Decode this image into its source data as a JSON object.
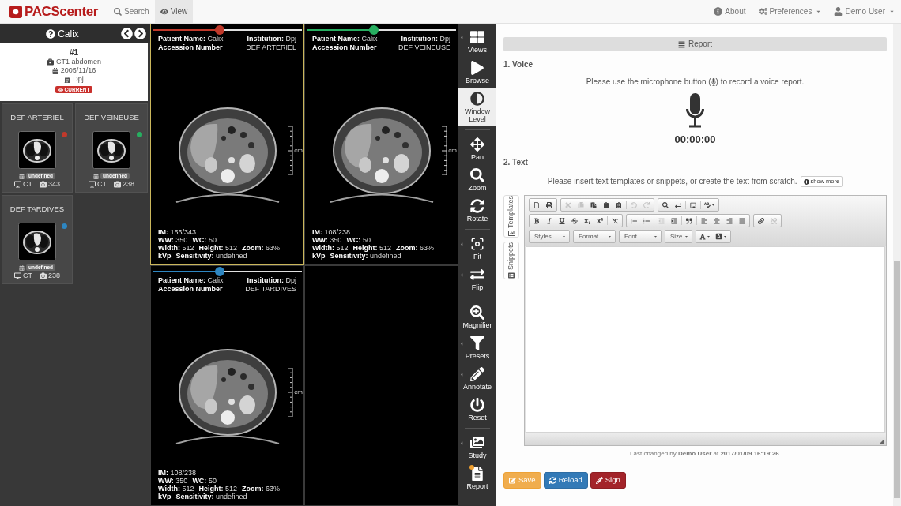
{
  "navbar": {
    "brand": "PACScenter",
    "tabs": [
      {
        "label": "Search",
        "selected": false
      },
      {
        "label": "View",
        "selected": true
      }
    ],
    "menu": [
      {
        "label": "About",
        "dropdown": false
      },
      {
        "label": "Preferences",
        "dropdown": true
      },
      {
        "label": "Demo User",
        "dropdown": true
      }
    ]
  },
  "sidebar": {
    "patient": "Calix",
    "study": {
      "number": "#1",
      "description": "CT1 abdomen",
      "date": "2005/11/16",
      "institution": "Dpj",
      "badge": "CURRENT"
    },
    "series": [
      {
        "title": "DEF ARTERIEL",
        "color": "#c0392b",
        "date": "undefined",
        "modality": "CT",
        "images": "343"
      },
      {
        "title": "DEF VEINEUSE",
        "color": "#27ae60",
        "date": "undefined",
        "modality": "CT",
        "images": "238"
      },
      {
        "title": "DEF TARDIVES",
        "color": "#2e86c1",
        "date": "undefined",
        "modality": "CT",
        "images": "238"
      }
    ]
  },
  "viewer": {
    "viewports": [
      {
        "kind": "series",
        "selected": true,
        "color": "#c0392b",
        "level": 0.45,
        "top": [
          [
            {
              "label": "Patient Name:",
              "value": "Calix"
            },
            {
              "label": "Institution:",
              "value": "Dpj"
            }
          ],
          [
            {
              "label": "Accession Number"
            },
            {
              "value": "DEF ARTERIEL"
            }
          ]
        ],
        "bottom": [
          [
            {
              "label": "IM:",
              "value": "156/343"
            }
          ],
          [
            {
              "label": "WW:",
              "value": "350"
            },
            {
              "label": "WC:",
              "value": "50"
            }
          ],
          [
            {
              "label": "Width:",
              "value": "512"
            },
            {
              "label": "Height:",
              "value": "512"
            },
            {
              "label": "Zoom:",
              "value": "63%"
            }
          ],
          [
            {
              "label": "kVp"
            },
            {
              "label": "Sensitivity:",
              "value": "undefined"
            }
          ]
        ],
        "ruler_unit": "cm"
      },
      {
        "kind": "series",
        "selected": false,
        "color": "#27ae60",
        "level": 0.45,
        "top": [
          [
            {
              "label": "Patient Name:",
              "value": "Calix"
            },
            {
              "label": "Institution:",
              "value": "Dpj"
            }
          ],
          [
            {
              "label": "Accession Number"
            },
            {
              "value": "DEF VEINEUSE"
            }
          ]
        ],
        "bottom": [
          [
            {
              "label": "IM:",
              "value": "108/238"
            }
          ],
          [
            {
              "label": "WW:",
              "value": "350"
            },
            {
              "label": "WC:",
              "value": "50"
            }
          ],
          [
            {
              "label": "Width:",
              "value": "512"
            },
            {
              "label": "Height:",
              "value": "512"
            },
            {
              "label": "Zoom:",
              "value": "63%"
            }
          ],
          [
            {
              "label": "kVp"
            },
            {
              "label": "Sensitivity:",
              "value": "undefined"
            }
          ]
        ],
        "ruler_unit": "cm"
      },
      {
        "kind": "series",
        "selected": false,
        "color": "#2e86c1",
        "level": 0.45,
        "top": [
          [
            {
              "label": "Patient Name:",
              "value": "Calix"
            },
            {
              "label": "Institution:",
              "value": "Dpj"
            }
          ],
          [
            {
              "label": "Accession Number"
            },
            {
              "value": "DEF TARDIVES"
            }
          ]
        ],
        "bottom": [
          [
            {
              "label": "IM:",
              "value": "108/238"
            }
          ],
          [
            {
              "label": "WW:",
              "value": "350"
            },
            {
              "label": "WC:",
              "value": "50"
            }
          ],
          [
            {
              "label": "Width:",
              "value": "512"
            },
            {
              "label": "Height:",
              "value": "512"
            },
            {
              "label": "Zoom:",
              "value": "63%"
            }
          ],
          [
            {
              "label": "kVp"
            },
            {
              "label": "Sensitivity:",
              "value": "undefined"
            }
          ]
        ],
        "ruler_unit": "cm"
      },
      {
        "kind": "empty"
      }
    ]
  },
  "tools": [
    [
      {
        "label": "Views",
        "selected": false,
        "submenu": true,
        "notice": false
      },
      {
        "label": "Browse",
        "selected": false,
        "submenu": false,
        "notice": false
      },
      {
        "label": "Window Level",
        "selected": true,
        "submenu": false,
        "notice": false
      }
    ],
    [
      {
        "label": "Pan",
        "selected": false,
        "submenu": false,
        "notice": false
      },
      {
        "label": "Zoom",
        "selected": false,
        "submenu": false,
        "notice": false
      },
      {
        "label": "Rotate",
        "selected": false,
        "submenu": false,
        "notice": false
      }
    ],
    [
      {
        "label": "Fit",
        "selected": false,
        "submenu": true,
        "notice": false
      },
      {
        "label": "Flip",
        "selected": false,
        "submenu": true,
        "notice": false
      }
    ],
    [
      {
        "label": "Magnifier",
        "selected": false,
        "submenu": false,
        "notice": false
      },
      {
        "label": "Presets",
        "selected": false,
        "submenu": true,
        "notice": false
      },
      {
        "label": "Annotate",
        "selected": false,
        "submenu": true,
        "notice": false
      },
      {
        "label": "Reset",
        "selected": false,
        "submenu": false,
        "notice": false
      }
    ],
    [
      {
        "label": "Study",
        "selected": false,
        "submenu": true,
        "notice": false
      },
      {
        "label": "Report",
        "selected": false,
        "submenu": false,
        "notice": true
      }
    ]
  ],
  "report": {
    "title": "Report",
    "voice": {
      "heading": "1. Voice",
      "hint_before": "Please use the microphone button (",
      "hint_after": ") to record a voice report.",
      "timer": "00:00:00"
    },
    "text": {
      "heading": "2. Text",
      "hint": "Please insert text templates or snippets, or create the text from scratch.",
      "more_button": "show more",
      "side_tabs": [
        "Templates",
        "Snippets"
      ],
      "editor": {
        "toolbar_rows": [
          [
            [
              [
                {
                  "disabled": false,
                  "dropdown": false
                },
                {
                  "disabled": false,
                  "dropdown": false
                }
              ]
            ],
            [
              [
                {
                  "disabled": true,
                  "dropdown": false
                },
                {
                  "disabled": true,
                  "dropdown": false
                },
                {
                  "disabled": false,
                  "dropdown": false
                },
                {
                  "disabled": false,
                  "dropdown": false
                },
                {
                  "disabled": false,
                  "dropdown": false
                }
              ],
              [
                {
                  "disabled": true,
                  "dropdown": false
                },
                {
                  "disabled": true,
                  "dropdown": false
                }
              ]
            ],
            [
              [
                {
                  "disabled": false,
                  "dropdown": false
                },
                {
                  "disabled": false,
                  "dropdown": false
                }
              ],
              [
                {
                  "disabled": false,
                  "dropdown": false
                }
              ],
              [
                {
                  "disabled": false,
                  "dropdown": true
                }
              ]
            ]
          ],
          [
            [
              [
                {
                  "disabled": false,
                  "dropdown": false
                },
                {
                  "disabled": false,
                  "dropdown": false
                },
                {
                  "disabled": false,
                  "dropdown": false
                },
                {
                  "disabled": false,
                  "dropdown": false
                },
                {
                  "disabled": false,
                  "dropdown": false
                },
                {
                  "disabled": false,
                  "dropdown": false
                }
              ],
              [
                {
                  "disabled": false,
                  "dropdown": false
                }
              ]
            ],
            [
              [
                {
                  "disabled": false,
                  "dropdown": false
                },
                {
                  "disabled": false,
                  "dropdown": false
                }
              ],
              [
                {
                  "disabled": true,
                  "dropdown": false
                },
                {
                  "disabled": false,
                  "dropdown": false
                }
              ],
              [
                {
                  "disabled": false,
                  "dropdown": false
                }
              ],
              [
                {
                  "disabled": false,
                  "dropdown": false
                },
                {
                  "disabled": false,
                  "dropdown": false
                },
                {
                  "disabled": false,
                  "dropdown": false
                },
                {
                  "disabled": false,
                  "dropdown": false
                }
              ]
            ],
            [
              [
                {
                  "disabled": false,
                  "dropdown": false
                },
                {
                  "disabled": true,
                  "dropdown": false
                }
              ]
            ]
          ]
        ],
        "combos": [
          "Styles",
          "Format",
          "Font",
          "Size"
        ]
      },
      "last_changed": "Last changed by **Demo User** at **2017/01/09 16:19:26**."
    },
    "actions": [
      {
        "label": "Save",
        "kind": "save"
      },
      {
        "label": "Reload",
        "kind": "reload"
      },
      {
        "label": "Sign",
        "kind": "sign"
      }
    ]
  }
}
